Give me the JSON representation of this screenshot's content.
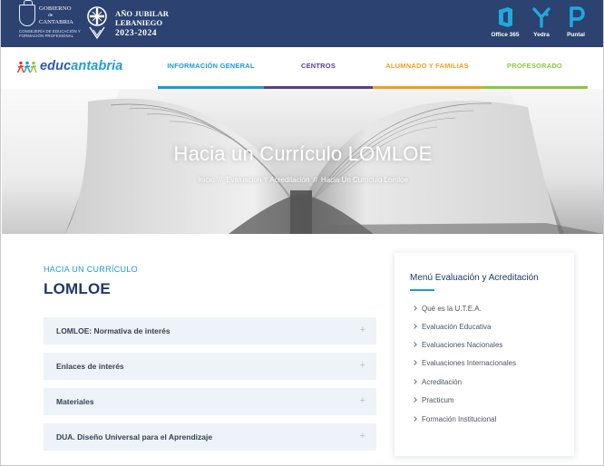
{
  "header": {
    "gov_line1": "GOBIERNO",
    "gov_line2": "de",
    "gov_line3": "CANTABRIA",
    "gov_line4": "CONSEJERÍA DE EDUCACIÓN Y FORMACIÓN PROFESIONAL",
    "jubilee_line1": "AÑO JUBILAR",
    "jubilee_line2": "LEBANIEGO",
    "jubilee_line3": "2023-2024",
    "quick_links": [
      {
        "label": "Office 365",
        "icon": "office-365-icon",
        "color": "#1ea9e0"
      },
      {
        "label": "Yedra",
        "icon": "yedra-icon",
        "color": "#1ea9e0"
      },
      {
        "label": "Puntal",
        "icon": "puntal-icon",
        "color": "#1ea9e0"
      }
    ]
  },
  "nav": {
    "logo_part1": "educ",
    "logo_part2": "antabria",
    "items": [
      {
        "label": "INFORMACIÓN GENERAL",
        "color": "#1c9ad6",
        "active": true
      },
      {
        "label": "CENTROS",
        "color": "#5a3d8e",
        "active": false
      },
      {
        "label": "ALUMNADO Y FAMILIAS",
        "color": "#f0a020",
        "active": false
      },
      {
        "label": "PROFESORADO",
        "color": "#8dc63f",
        "active": false
      }
    ]
  },
  "hero": {
    "title": "Hacia un Currículo LOMLOE",
    "breadcrumb": [
      "Inicio",
      "Evaluación Y Acreditación",
      "Hacia Un Currículo Lomloe"
    ],
    "separator": "//"
  },
  "main": {
    "subtitle": "HACIA UN CURRÍCULO",
    "title": "LOMLOE",
    "accordion": [
      {
        "label": "LOMLOE: Normativa de interés"
      },
      {
        "label": "Enlaces de interés"
      },
      {
        "label": "Materiales"
      },
      {
        "label": "DUA. Diseño Universal para el Aprendizaje"
      }
    ],
    "plus_symbol": "+"
  },
  "sidebar": {
    "title": "Menú Evaluación y Acreditación",
    "links": [
      "Qué es la U.T.E.A.",
      "Evaluación Educativa",
      "Evaluaciones Nacionales",
      "Evaluaciones Internacionales",
      "Acreditación",
      "Practicum",
      "Formación Institucional"
    ]
  },
  "colors": {
    "topbar": "#2c4270",
    "brand_blue": "#2a5ba8",
    "accent_blue": "#1c9ad6",
    "title_navy": "#1e3a66",
    "accordion_bg": "#eef2f9"
  }
}
